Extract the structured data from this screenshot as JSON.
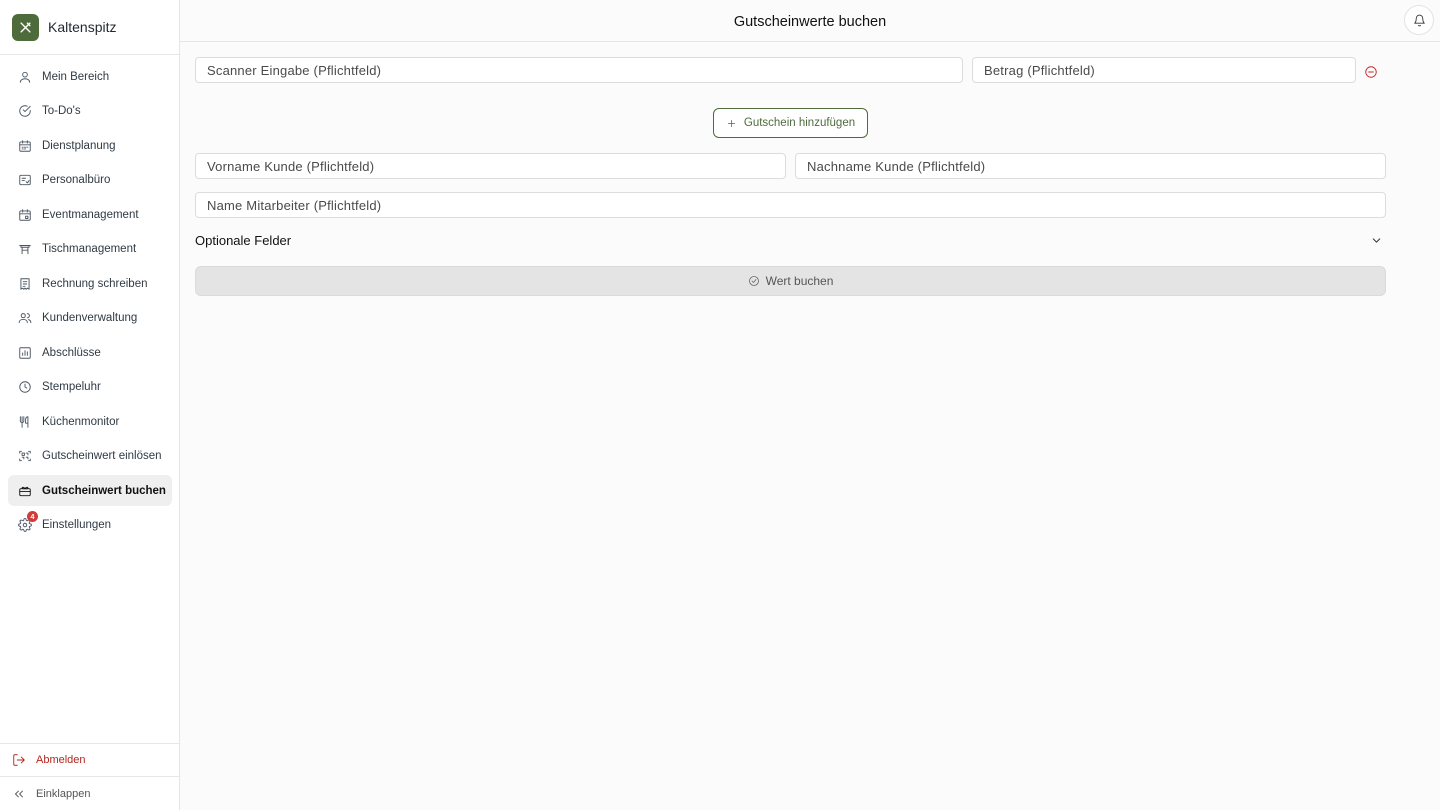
{
  "brand": {
    "name": "Kaltenspitz",
    "logo_icon": "utensils-crossed-icon",
    "color": "#4e6b3c"
  },
  "sidebar": {
    "items": [
      {
        "label": "Mein Bereich",
        "icon": "user-icon"
      },
      {
        "label": "To-Do's",
        "icon": "check-circle-icon"
      },
      {
        "label": "Dienstplanung",
        "icon": "calendar-icon"
      },
      {
        "label": "Personalbüro",
        "icon": "id-card-icon"
      },
      {
        "label": "Eventmanagement",
        "icon": "calendar-event-icon"
      },
      {
        "label": "Tischmanagement",
        "icon": "table-icon"
      },
      {
        "label": "Rechnung schreiben",
        "icon": "receipt-icon"
      },
      {
        "label": "Kundenverwaltung",
        "icon": "users-icon"
      },
      {
        "label": "Abschlüsse",
        "icon": "bar-chart-icon"
      },
      {
        "label": "Stempeluhr",
        "icon": "clock-icon"
      },
      {
        "label": "Küchenmonitor",
        "icon": "utensils-icon"
      },
      {
        "label": "Gutscheinwert einlösen",
        "icon": "scan-icon"
      },
      {
        "label": "Gutscheinwert buchen",
        "icon": "gift-card-icon",
        "active": true
      },
      {
        "label": "Einstellungen",
        "icon": "gear-icon",
        "badge": "4"
      }
    ],
    "logout_label": "Abmelden",
    "collapse_label": "Einklappen"
  },
  "header": {
    "title": "Gutscheinwerte buchen"
  },
  "form": {
    "scanner_placeholder": "Scanner Eingabe (Pflichtfeld)",
    "amount_placeholder": "Betrag (Pflichtfeld)",
    "add_voucher_label": "Gutschein hinzufügen",
    "first_name_placeholder": "Vorname Kunde (Pflichtfeld)",
    "last_name_placeholder": "Nachname Kunde (Pflichtfeld)",
    "employee_placeholder": "Name Mitarbeiter (Pflichtfeld)",
    "optional_label": "Optionale Felder",
    "submit_label": "Wert buchen"
  },
  "colors": {
    "accent": "#4e6b3c",
    "danger": "#c62828",
    "badge": "#d33a3a"
  }
}
